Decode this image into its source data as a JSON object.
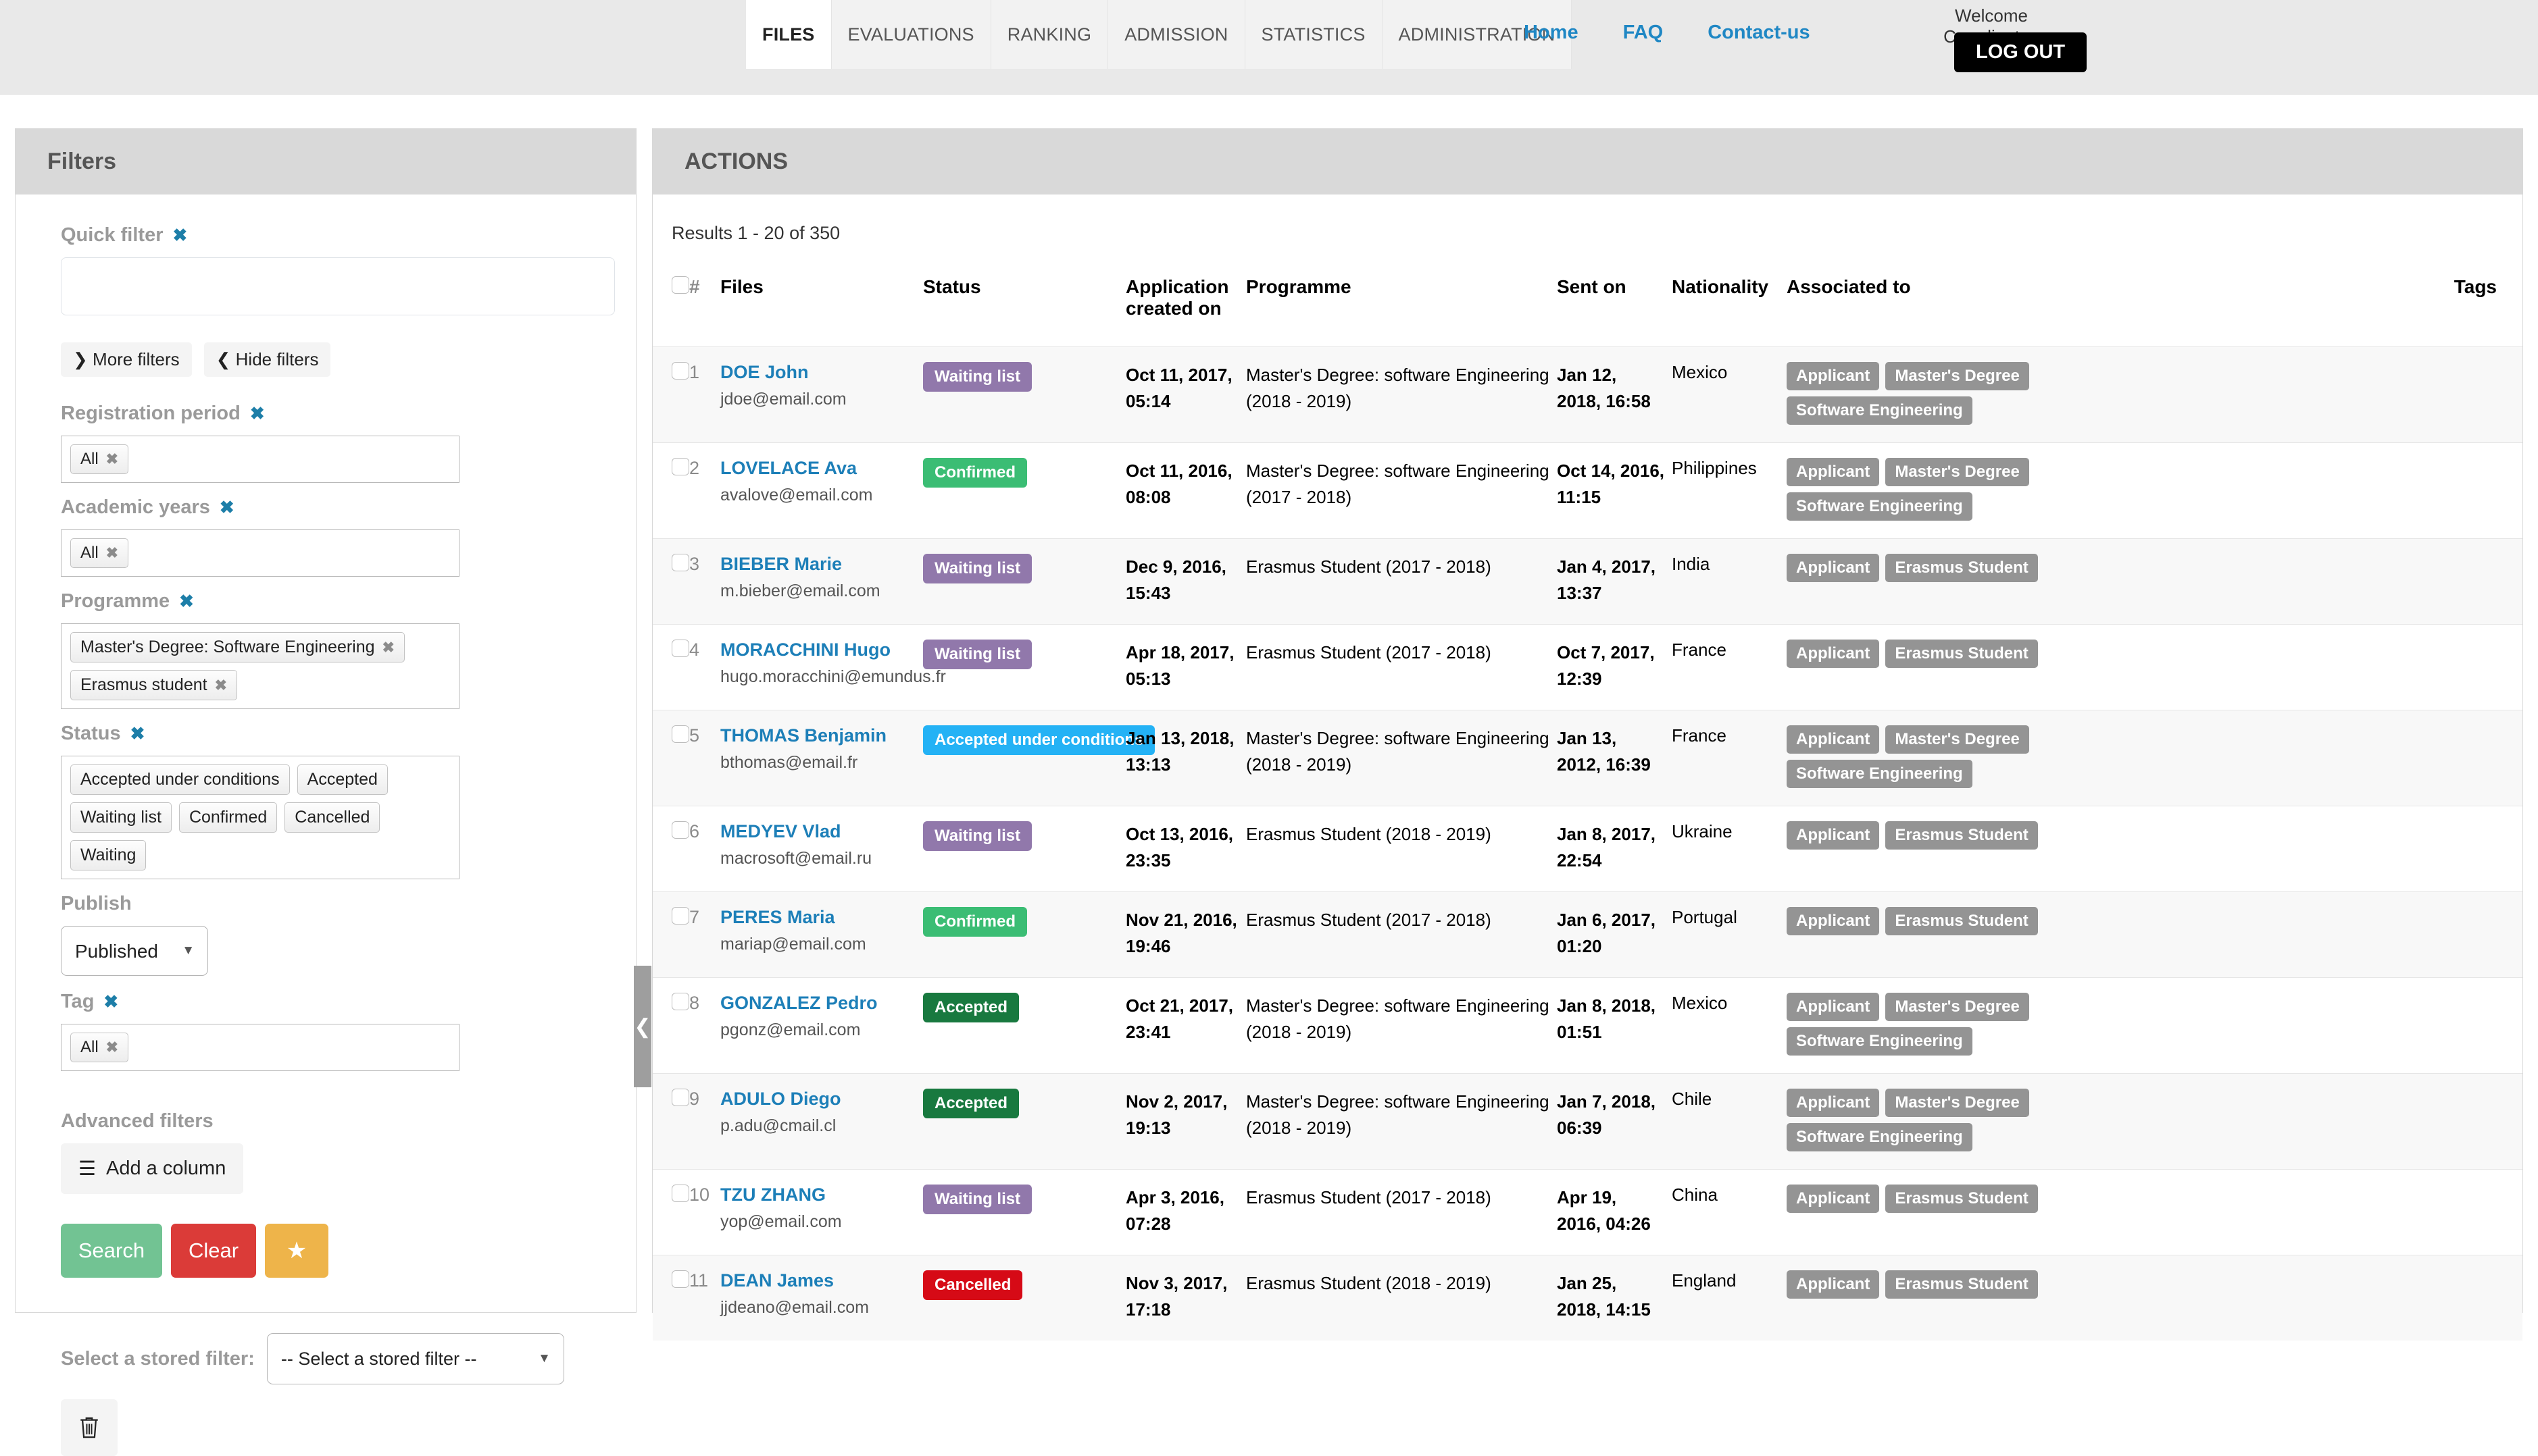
{
  "header": {
    "tabs": [
      {
        "label": "FILES",
        "active": true
      },
      {
        "label": "EVALUATIONS",
        "active": false
      },
      {
        "label": "RANKING",
        "active": false
      },
      {
        "label": "ADMISSION",
        "active": false
      },
      {
        "label": "STATISTICS",
        "active": false
      },
      {
        "label": "ADMINISTRATION",
        "active": false
      }
    ],
    "links": [
      "Home",
      "FAQ",
      "Contact-us"
    ],
    "welcome": "Welcome Coordinator,",
    "logout_label": "LOG OUT"
  },
  "sidebar": {
    "title": "Filters",
    "quick_filter": {
      "label": "Quick filter",
      "value": "",
      "placeholder": ""
    },
    "more_filters_label": "More filters",
    "hide_filters_label": "Hide filters",
    "registration_period": {
      "label": "Registration period",
      "chips": [
        "All"
      ]
    },
    "academic_years": {
      "label": "Academic years",
      "chips": [
        "All"
      ]
    },
    "programme": {
      "label": "Programme",
      "chips": [
        "Master's Degree: Software Engineering",
        "Erasmus student"
      ]
    },
    "status": {
      "label": "Status",
      "chips": [
        "Accepted under conditions",
        "Accepted",
        "Waiting list",
        "Confirmed",
        "Cancelled",
        "Waiting"
      ]
    },
    "publish": {
      "label": "Publish",
      "value": "Published"
    },
    "tag": {
      "label": "Tag",
      "chips": [
        "All"
      ]
    },
    "advanced_filters_label": "Advanced filters",
    "add_column_label": "Add a column",
    "search_label": "Search",
    "clear_label": "Clear",
    "star_label": "★",
    "stored_filter": {
      "label": "Select a stored filter:",
      "value": "-- Select a stored filter --"
    }
  },
  "main": {
    "title": "ACTIONS",
    "results": "Results 1 - 20 of 350",
    "columns": [
      "#",
      "Files",
      "Status",
      "Application created on",
      "Programme",
      "Sent on",
      "Nationality",
      "Associated to",
      "Tags"
    ],
    "rows": [
      {
        "num": "1",
        "name": "DOE John",
        "email": "jdoe@email.com",
        "status": "Waiting list",
        "status_key": "b-waiting-list",
        "created": "Oct 11, 2017, 05:14",
        "programme": "Master's Degree: software Engineering (2018 - 2019)",
        "sent": "Jan 12, 2018, 16:58",
        "nationality": "Mexico",
        "tags": [
          "Applicant",
          "Master's Degree",
          "Software Engineering"
        ]
      },
      {
        "num": "2",
        "name": "LOVELACE Ava",
        "email": "avalove@email.com",
        "status": "Confirmed",
        "status_key": "b-confirmed",
        "created": "Oct 11, 2016, 08:08",
        "programme": "Master's Degree: software Engineering (2017 - 2018)",
        "sent": "Oct 14, 2016, 11:15",
        "nationality": "Philippines",
        "tags": [
          "Applicant",
          "Master's Degree",
          "Software Engineering"
        ]
      },
      {
        "num": "3",
        "name": "BIEBER Marie",
        "email": "m.bieber@email.com",
        "status": "Waiting list",
        "status_key": "b-waiting-list",
        "created": "Dec 9, 2016, 15:43",
        "programme": "Erasmus Student (2017 - 2018)",
        "sent": "Jan 4, 2017, 13:37",
        "nationality": "India",
        "tags": [
          "Applicant",
          "Erasmus Student"
        ]
      },
      {
        "num": "4",
        "name": "MORACCHINI Hugo",
        "email": "hugo.moracchini@emundus.fr",
        "status": "Waiting list",
        "status_key": "b-waiting-list",
        "created": "Apr 18, 2017, 05:13",
        "programme": "Erasmus Student (2017 - 2018)",
        "sent": "Oct 7, 2017, 12:39",
        "nationality": "France",
        "tags": [
          "Applicant",
          "Erasmus Student"
        ]
      },
      {
        "num": "5",
        "name": "THOMAS Benjamin",
        "email": "bthomas@email.fr",
        "status": "Accepted under conditions",
        "status_key": "b-accepted-under-conditions",
        "created": "Jan 13, 2018, 13:13",
        "programme": "Master's Degree: software Engineering (2018 - 2019)",
        "sent": "Jan 13, 2012, 16:39",
        "nationality": "France",
        "tags": [
          "Applicant",
          "Master's Degree",
          "Software Engineering"
        ]
      },
      {
        "num": "6",
        "name": "MEDYEV Vlad",
        "email": "macrosoft@email.ru",
        "status": "Waiting list",
        "status_key": "b-waiting-list",
        "created": "Oct 13, 2016, 23:35",
        "programme": "Erasmus Student (2018 - 2019)",
        "sent": "Jan 8, 2017, 22:54",
        "nationality": "Ukraine",
        "tags": [
          "Applicant",
          "Erasmus Student"
        ]
      },
      {
        "num": "7",
        "name": "PERES Maria",
        "email": "mariap@email.com",
        "status": "Confirmed",
        "status_key": "b-confirmed",
        "created": "Nov 21, 2016, 19:46",
        "programme": "Erasmus Student (2017 - 2018)",
        "sent": "Jan 6, 2017, 01:20",
        "nationality": "Portugal",
        "tags": [
          "Applicant",
          "Erasmus Student"
        ]
      },
      {
        "num": "8",
        "name": "GONZALEZ Pedro",
        "email": "pgonz@email.com",
        "status": "Accepted",
        "status_key": "b-accepted",
        "created": "Oct 21, 2017, 23:41",
        "programme": "Master's Degree: software Engineering (2018 - 2019)",
        "sent": "Jan 8, 2018, 01:51",
        "nationality": "Mexico",
        "tags": [
          "Applicant",
          "Master's Degree",
          "Software Engineering"
        ]
      },
      {
        "num": "9",
        "name": "ADULO Diego",
        "email": "p.adu@cmail.cl",
        "status": "Accepted",
        "status_key": "b-accepted",
        "created": "Nov 2, 2017, 19:13",
        "programme": "Master's Degree: software Engineering (2018 - 2019)",
        "sent": "Jan 7, 2018, 06:39",
        "nationality": "Chile",
        "tags": [
          "Applicant",
          "Master's Degree",
          "Software Engineering"
        ]
      },
      {
        "num": "10",
        "name": "TZU ZHANG",
        "email": "yop@email.com",
        "status": "Waiting list",
        "status_key": "b-waiting-list",
        "created": "Apr 3, 2016, 07:28",
        "programme": "Erasmus Student (2017 - 2018)",
        "sent": "Apr 19, 2016, 04:26",
        "nationality": "China",
        "tags": [
          "Applicant",
          "Erasmus Student"
        ]
      },
      {
        "num": "11",
        "name": "DEAN James",
        "email": "jjdeano@email.com",
        "status": "Cancelled",
        "status_key": "b-cancelled",
        "created": "Nov 3, 2017, 17:18",
        "programme": "Erasmus Student (2018 - 2019)",
        "sent": "Jan 25, 2018, 14:15",
        "nationality": "England",
        "tags": [
          "Applicant",
          "Erasmus Student"
        ]
      }
    ]
  },
  "colors": {
    "link": "#1d7fb8",
    "waiting_list": "#9178ab",
    "confirmed": "#3bbd74",
    "accepted_under_conditions": "#24b2f5",
    "accepted": "#18793f",
    "cancelled": "#d60a16",
    "search": "#72c393",
    "clear": "#db3b38",
    "star": "#eeb44a",
    "tag": "#949494"
  }
}
